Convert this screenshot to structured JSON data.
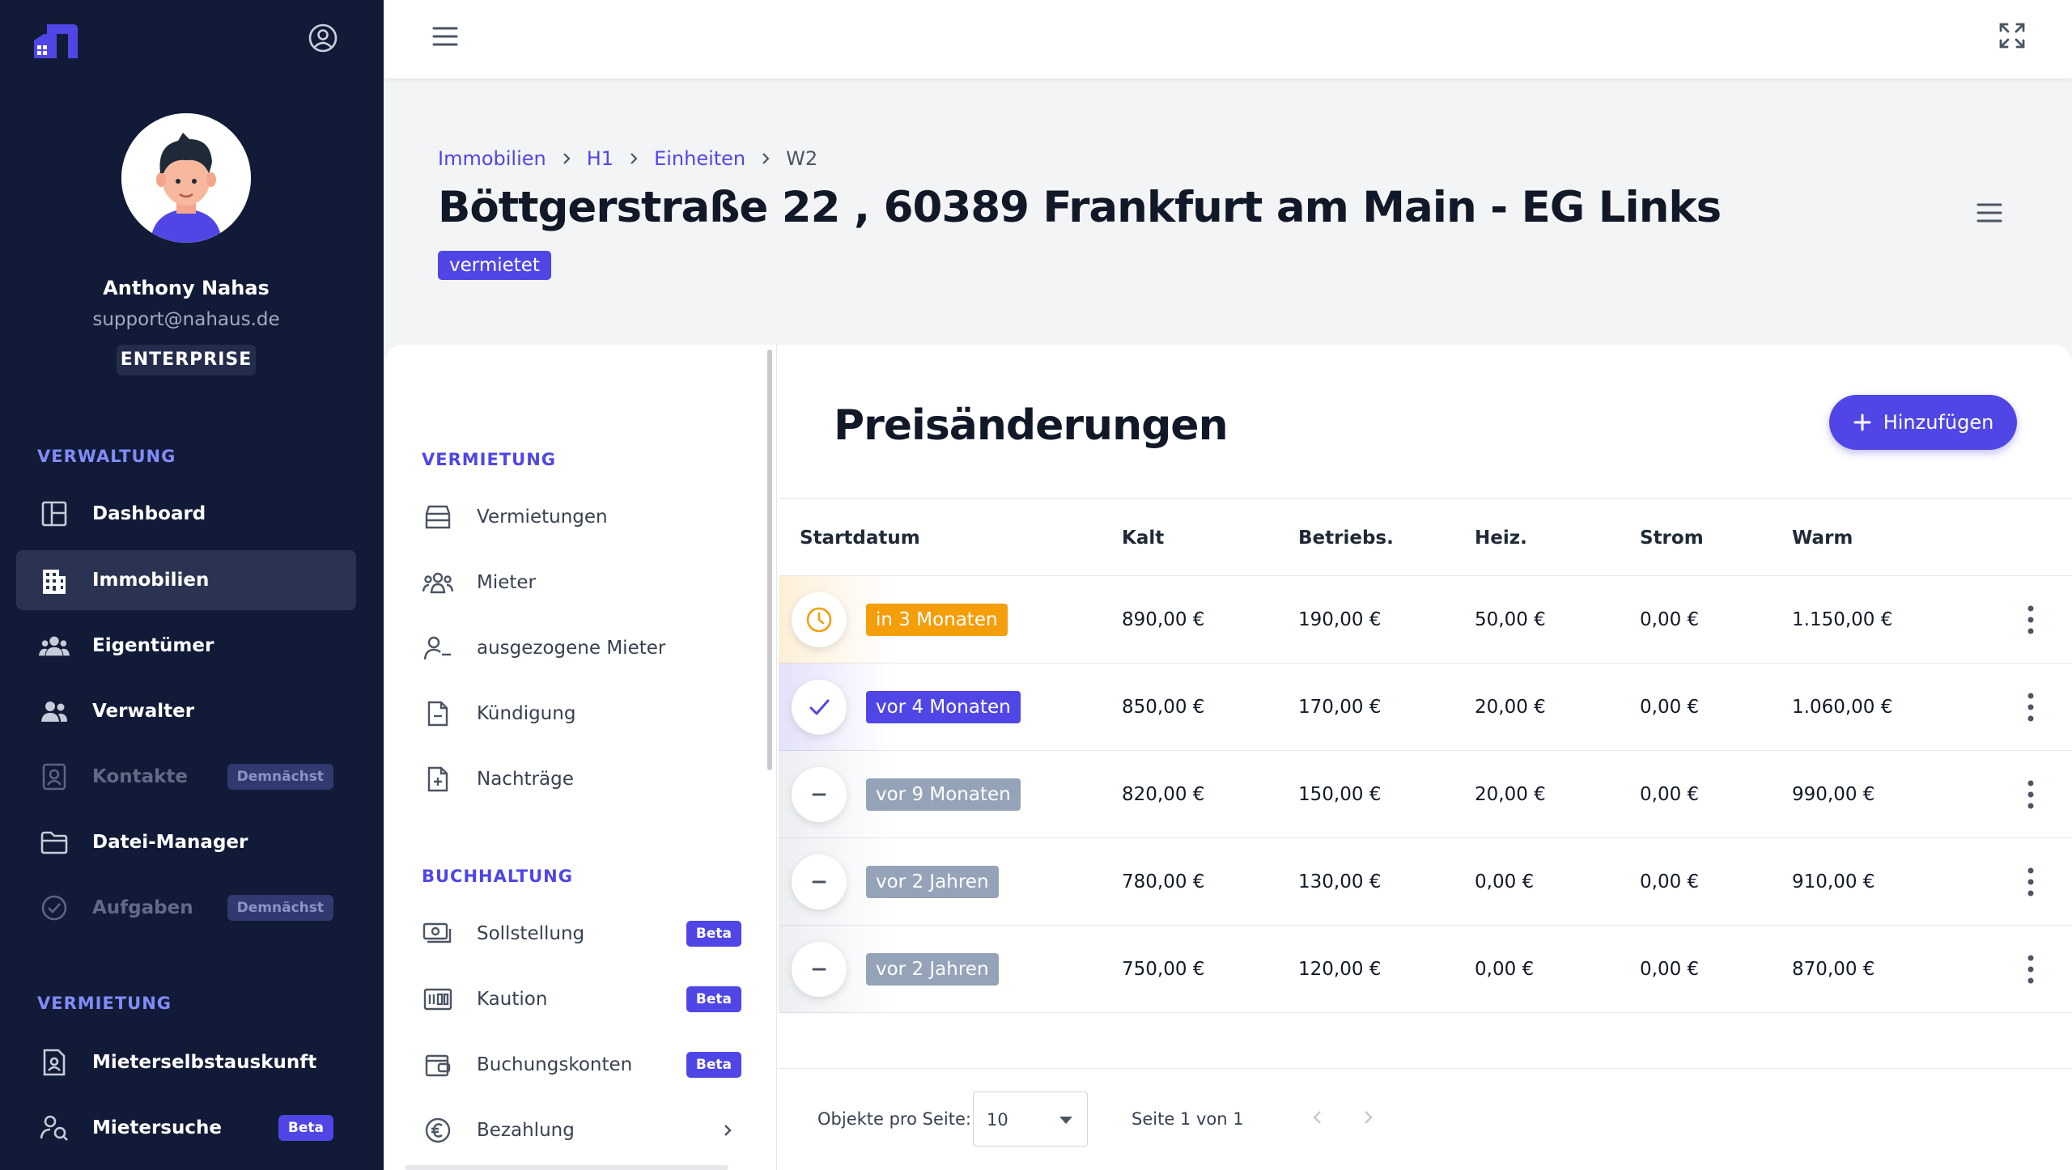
{
  "sidebar": {
    "user": {
      "name": "Anthony Nahas",
      "email": "support@nahaus.de",
      "plan": "ENTERPRISE"
    },
    "sections": [
      {
        "title": "VERWALTUNG",
        "items": [
          {
            "label": "Dashboard",
            "icon": "dashboard-icon"
          },
          {
            "label": "Immobilien",
            "icon": "building-icon",
            "active": true
          },
          {
            "label": "Eigentümer",
            "icon": "users-icon"
          },
          {
            "label": "Verwalter",
            "icon": "user-group-icon"
          },
          {
            "label": "Kontakte",
            "icon": "contacts-icon",
            "badge": "Demnächst",
            "disabled": true
          },
          {
            "label": "Datei-Manager",
            "icon": "folder-icon"
          },
          {
            "label": "Aufgaben",
            "icon": "check-circle-icon",
            "badge": "Demnächst",
            "disabled": true
          }
        ]
      },
      {
        "title": "VERMIETUNG",
        "items": [
          {
            "label": "Mieterselbstauskunft",
            "icon": "document-user-icon"
          },
          {
            "label": "Mietersuche",
            "icon": "user-search-icon",
            "badge": "Beta"
          }
        ]
      }
    ]
  },
  "breadcrumb": [
    "Immobilien",
    "H1",
    "Einheiten",
    "W2"
  ],
  "page": {
    "title": "Böttgerstraße 22 , 60389 Frankfurt am Main - EG Links",
    "status": "vermietet"
  },
  "subnav": {
    "sections": [
      {
        "title": "VERMIETUNG",
        "items": [
          {
            "label": "Vermietungen",
            "icon": "archive-icon"
          },
          {
            "label": "Mieter",
            "icon": "tenants-icon"
          },
          {
            "label": "ausgezogene Mieter",
            "icon": "user-minus-icon"
          },
          {
            "label": "Kündigung",
            "icon": "document-minus-icon"
          },
          {
            "label": "Nachträge",
            "icon": "document-plus-icon"
          }
        ]
      },
      {
        "title": "BUCHHALTUNG",
        "items": [
          {
            "label": "Sollstellung",
            "icon": "cash-icon",
            "badge": "Beta"
          },
          {
            "label": "Kaution",
            "icon": "deposit-icon",
            "badge": "Beta"
          },
          {
            "label": "Buchungskonten",
            "icon": "wallet-icon",
            "badge": "Beta"
          },
          {
            "label": "Bezahlung",
            "icon": "euro-icon",
            "chevron": true
          }
        ]
      }
    ]
  },
  "content": {
    "title": "Preisänderungen",
    "add_button": "Hinzufügen",
    "columns": [
      "Startdatum",
      "Kalt",
      "Betriebs.",
      "Heiz.",
      "Strom",
      "Warm"
    ],
    "rows": [
      {
        "status": "future",
        "status_icon": "clock-icon",
        "date": "in 3 Monaten",
        "pill_color": "#f59e0b",
        "kalt": "890,00 €",
        "betriebs": "190,00 €",
        "heiz": "50,00 €",
        "strom": "0,00 €",
        "warm": "1.150,00 €"
      },
      {
        "status": "current",
        "status_icon": "check-icon",
        "date": "vor 4 Monaten",
        "pill_color": "#4f46e5",
        "kalt": "850,00 €",
        "betriebs": "170,00 €",
        "heiz": "20,00 €",
        "strom": "0,00 €",
        "warm": "1.060,00 €"
      },
      {
        "status": "past",
        "status_icon": "minus-icon",
        "date": "vor 9 Monaten",
        "pill_color": "#94a3b8",
        "kalt": "820,00 €",
        "betriebs": "150,00 €",
        "heiz": "20,00 €",
        "strom": "0,00 €",
        "warm": "990,00 €"
      },
      {
        "status": "past",
        "status_icon": "minus-icon",
        "date": "vor 2 Jahren",
        "pill_color": "#94a3b8",
        "kalt": "780,00 €",
        "betriebs": "130,00 €",
        "heiz": "0,00 €",
        "strom": "0,00 €",
        "warm": "910,00 €"
      },
      {
        "status": "past",
        "status_icon": "minus-icon",
        "date": "vor 2 Jahren",
        "pill_color": "#94a3b8",
        "kalt": "750,00 €",
        "betriebs": "120,00 €",
        "heiz": "0,00 €",
        "strom": "0,00 €",
        "warm": "870,00 €"
      }
    ],
    "pagination": {
      "per_page_label": "Objekte pro Seite:",
      "per_page_value": "10",
      "page_info": "Seite 1 von 1"
    }
  },
  "colors": {
    "sidebar_bg": "#111a37",
    "accent": "#4f46e5",
    "future": "#f59e0b",
    "past": "#94a3b8"
  }
}
